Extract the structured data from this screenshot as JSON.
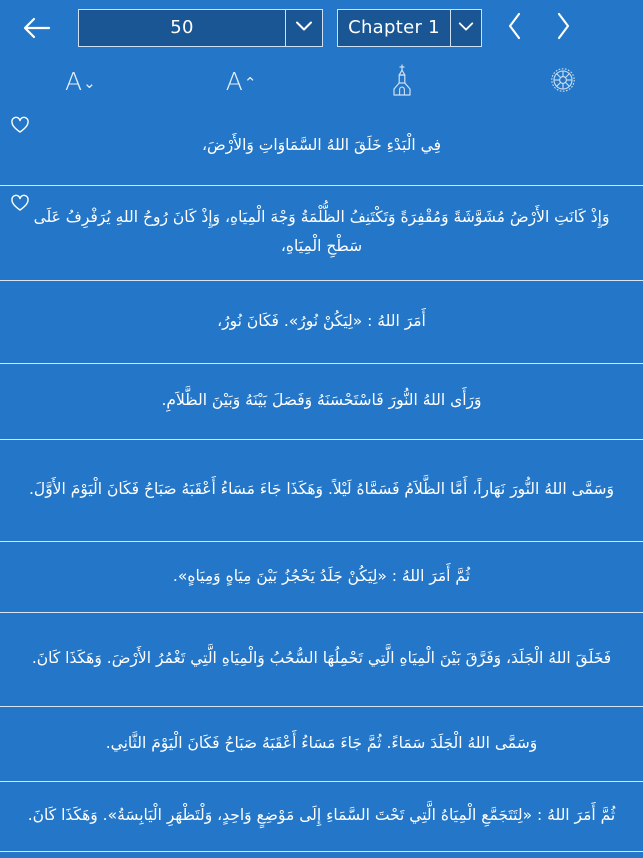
{
  "toolbar": {
    "back_icon": "arrow-left-icon",
    "page_selector": {
      "value": "50",
      "arrow_icon": "chevron-down-icon"
    },
    "chapter_selector": {
      "value": "Chapter 1",
      "arrow_icon": "chevron-down-icon"
    },
    "prev_icon": "chevron-left-icon",
    "next_icon": "chevron-right-icon"
  },
  "iconbar": {
    "items": [
      {
        "name": "decrease-font-size",
        "letter": "A",
        "chevron": "⌄",
        "icon": "font-decrease-icon"
      },
      {
        "name": "increase-font-size",
        "letter": "A",
        "chevron": "⌃",
        "icon": "font-increase-icon"
      },
      {
        "name": "church",
        "icon": "church-icon"
      },
      {
        "name": "settings",
        "icon": "gear-icon"
      }
    ]
  },
  "colors": {
    "background": "#2477c8",
    "field_fill": "#1a5693",
    "border": "#cfe0f2",
    "text": "#ffffff",
    "divider": "#d6e6f5"
  },
  "verses": [
    {
      "favorite_icon": "heart-outline-icon",
      "has_favorite": true,
      "text": "فِي الْبَدْءِ خَلَقَ اللهُ السَّمَاوَاتِ وَالأَرْضَ،"
    },
    {
      "favorite_icon": "heart-outline-icon",
      "has_favorite": true,
      "text": "وَإِذْ كَانَتِ الأَرْضُ مُشَوَّشَةً وَمُقْفِرَةً وَتَكْتَنِفُ الظُّلْمَةُ وَجْهَ الْمِيَاهِ، وَإِذْ كَانَ رُوحُ اللهِ يُرَفْرِفُ عَلَى سَطْحِ الْمِيَاهِ،"
    },
    {
      "has_favorite": false,
      "text": "أَمَرَ اللهُ : «لِيَكُنْ نُورُ». فَكَانَ نُورُ،"
    },
    {
      "has_favorite": false,
      "text": "وَرَأَى اللهُ النُّورَ فَاسْتَحْسَنَهُ وَفَصَلَ بَيْنَهُ وَبَيْنَ الظَّلاَمِ."
    },
    {
      "has_favorite": false,
      "text": "وَسَمَّى اللهُ النُّورَ نَهَاراً، أَمَّا الظَّلاَمُ فَسَمَّاهُ لَيْلاً. وَهَكَذَا جَاءَ مَسَاءُ أَعْقَبَهُ صَبَاحُ فَكَانَ الْيَوْمَ الأَوَّلَ."
    },
    {
      "has_favorite": false,
      "text": "ثُمَّ أَمَرَ اللهُ : «لِيَكُنْ جَلَدُ يَحْجُزُ بَيْنَ مِيَاهٍ وَمِيَاهٍ»."
    },
    {
      "has_favorite": false,
      "text": "فَخَلَقَ اللهُ الْجَلَدَ، وَفَرَّقَ بَيْنَ الْمِيَاهِ الَّتِي تَحْمِلُهَا السُّحُبُ وَالْمِيَاهِ الَّتِي تَغْمُرُ الأَرْضَ. وَهَكَذَا كَانَ."
    },
    {
      "has_favorite": false,
      "text": "وَسَمَّى اللهُ الْجَلَدَ سَمَاءً. ثُمَّ جَاءَ مَسَاءُ أَعْقَبَهُ صَبَاحُ فَكَانَ الْيَوْمَ الثَّانِي."
    },
    {
      "has_favorite": false,
      "text": "ثُمَّ أَمَرَ اللهُ : «لِتَتَجَمَّعِ الْمِيَاهُ الَّتِي تَحْتَ السَّمَاءِ إِلَى مَوْضِعٍ وَاحِدٍ، وَلْتَظْهَرِ الْيَابِسَةُ». وَهَكَذَا كَانَ."
    }
  ]
}
